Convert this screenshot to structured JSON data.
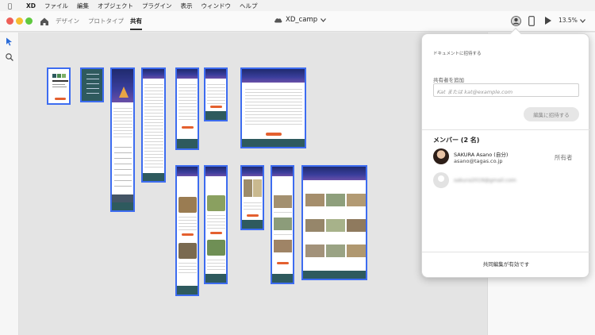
{
  "menubar": {
    "app": "XD",
    "items": [
      "ファイル",
      "編集",
      "オブジェクト",
      "プラグイン",
      "表示",
      "ウィンドウ",
      "ヘルプ"
    ]
  },
  "titlebar": {
    "tabs": [
      "デザイン",
      "プロトタイプ",
      "共有"
    ],
    "active_tab": "共有",
    "doc_name": "XD_camp",
    "zoom": "13.5%"
  },
  "colors": {
    "accent": "#3d6cf0",
    "artboard_border": "#3d6cf0",
    "orange_button": "#e4602f",
    "teal_footer": "#2e5a5e"
  },
  "share_popup": {
    "title": "ドキュメントに招待する",
    "add_label": "共有者を追加",
    "input_placeholder": "Kat または kat@example.com",
    "invite_button": "編集に招待する",
    "members_heading": "メンバー (2 名)",
    "members": [
      {
        "name": "SAKURA Asano (自分)",
        "email": "asano@tagas.co.jp",
        "role": "所有者"
      },
      {
        "name": "",
        "email": "sakura2019@gmail.com",
        "role": ""
      }
    ],
    "footer": "共同編集が有効です"
  },
  "icons": {
    "apple": "apple-logo-icon",
    "home": "home-icon",
    "cloud": "cloud-icon",
    "user": "user-circle-icon",
    "mobile": "mobile-preview-icon",
    "play": "play-icon",
    "select": "select-arrow-icon",
    "zoom": "zoom-search-icon"
  }
}
